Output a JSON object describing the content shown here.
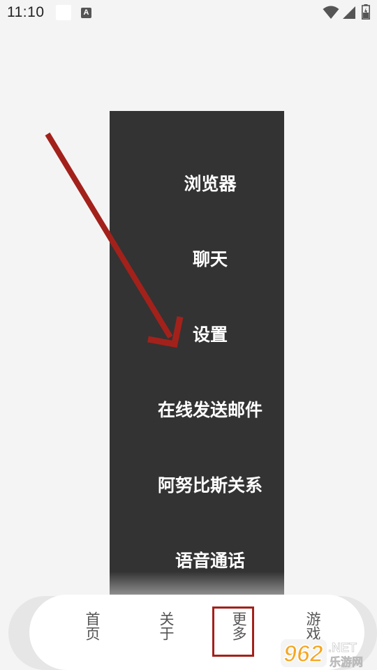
{
  "status_bar": {
    "time": "11:10",
    "icons": [
      "notification-square",
      "a-letter-icon",
      "wifi-icon",
      "signal-icon",
      "battery-icon"
    ],
    "a_glyph": "A"
  },
  "menu": {
    "items": [
      {
        "label": "浏览器"
      },
      {
        "label": "聊天"
      },
      {
        "label": "设置"
      },
      {
        "label": "在线发送邮件"
      },
      {
        "label": "阿努比斯关系"
      },
      {
        "label": "语音通话"
      }
    ]
  },
  "bottom_nav": {
    "items": [
      {
        "label": "首页"
      },
      {
        "label": "关于"
      },
      {
        "label": "更多",
        "highlighted": true
      },
      {
        "label": "游戏"
      }
    ]
  },
  "watermark": {
    "brand": "962",
    "suffix": ".NET",
    "tagline": "乐游网"
  },
  "colors": {
    "background": "#f4f4f4",
    "menu_bg": "#333333",
    "menu_text": "#ffffff",
    "annotation_red": "#a3211b",
    "nav_text": "#555555"
  }
}
